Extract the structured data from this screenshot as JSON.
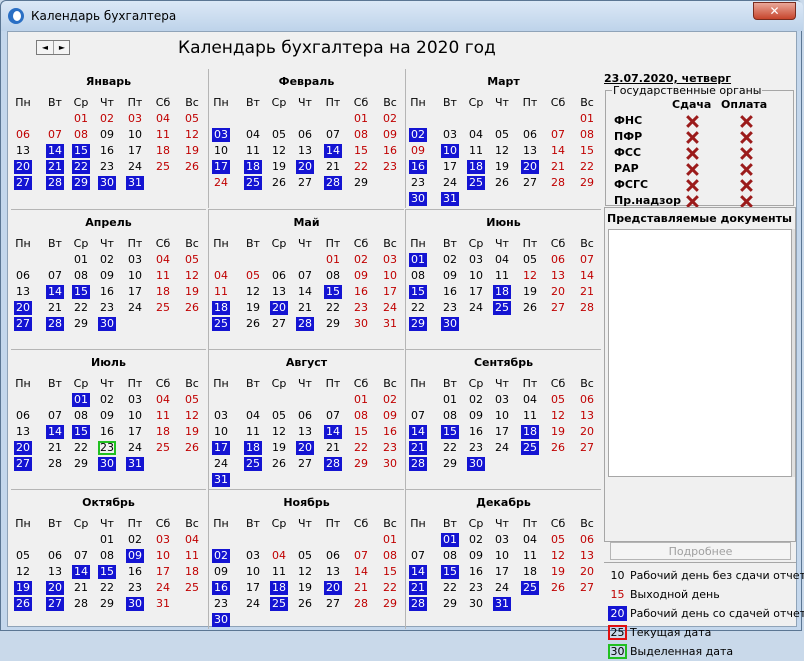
{
  "window": {
    "title": "Календарь бухгалтера",
    "close_label": "✕"
  },
  "nav": {
    "prev": "◄",
    "next": "►"
  },
  "header": {
    "title": "Календарь бухгалтера на 2020 год"
  },
  "weekdays": [
    "Пн",
    "Вт",
    "Ср",
    "Чт",
    "Пт",
    "Сб",
    "Вс"
  ],
  "months": [
    {
      "name": "Январь",
      "offset": 2,
      "days": 31,
      "weekends": [
        4,
        5,
        11,
        12,
        18,
        19,
        25,
        26
      ],
      "holidays": [
        1,
        2,
        3,
        6,
        7,
        8
      ],
      "reporting": [
        14,
        15,
        20,
        21,
        22,
        27,
        28,
        29,
        30,
        31
      ]
    },
    {
      "name": "Февраль",
      "offset": 5,
      "days": 29,
      "weekends": [
        1,
        2,
        8,
        9,
        15,
        16,
        22,
        23,
        24
      ],
      "holidays": [],
      "reporting": [
        3,
        14,
        17,
        18,
        20,
        25,
        28
      ]
    },
    {
      "name": "Март",
      "offset": 6,
      "days": 31,
      "weekends": [
        1,
        7,
        8,
        9,
        14,
        15,
        21,
        22,
        28,
        29
      ],
      "holidays": [],
      "reporting": [
        2,
        10,
        16,
        18,
        20,
        25,
        30,
        31
      ]
    },
    {
      "name": "Апрель",
      "offset": 2,
      "days": 30,
      "weekends": [
        4,
        5,
        11,
        12,
        18,
        19,
        25,
        26
      ],
      "holidays": [],
      "reporting": [
        14,
        15,
        20,
        27,
        28,
        30
      ]
    },
    {
      "name": "Май",
      "offset": 4,
      "days": 31,
      "weekends": [
        1,
        2,
        3,
        4,
        5,
        9,
        10,
        11,
        16,
        17,
        23,
        24,
        30,
        31
      ],
      "holidays": [],
      "reporting": [
        15,
        18,
        20,
        25,
        28
      ]
    },
    {
      "name": "Июнь",
      "offset": 0,
      "days": 30,
      "weekends": [
        6,
        7,
        12,
        13,
        14,
        20,
        21,
        27,
        28
      ],
      "holidays": [],
      "reporting": [
        1,
        15,
        18,
        25,
        29,
        30
      ]
    },
    {
      "name": "Июль",
      "offset": 2,
      "days": 31,
      "weekends": [
        4,
        5,
        11,
        12,
        18,
        19,
        25,
        26
      ],
      "holidays": [],
      "reporting": [
        1,
        14,
        15,
        20,
        27,
        30,
        31
      ]
    },
    {
      "name": "Август",
      "offset": 5,
      "days": 31,
      "weekends": [
        1,
        2,
        8,
        9,
        15,
        16,
        22,
        23,
        29,
        30
      ],
      "holidays": [],
      "reporting": [
        14,
        17,
        18,
        20,
        25,
        28,
        31
      ]
    },
    {
      "name": "Сентябрь",
      "offset": 1,
      "days": 30,
      "weekends": [
        5,
        6,
        12,
        13,
        19,
        20,
        26,
        27
      ],
      "holidays": [],
      "reporting": [
        14,
        15,
        18,
        21,
        25,
        28,
        30
      ]
    },
    {
      "name": "Октябрь",
      "offset": 3,
      "days": 31,
      "weekends": [
        3,
        4,
        10,
        11,
        17,
        18,
        24,
        25,
        31
      ],
      "holidays": [],
      "reporting": [
        9,
        14,
        15,
        19,
        20,
        26,
        27,
        30
      ]
    },
    {
      "name": "Ноябрь",
      "offset": 6,
      "days": 30,
      "weekends": [
        1,
        4,
        7,
        8,
        14,
        15,
        21,
        22,
        28,
        29
      ],
      "holidays": [],
      "reporting": [
        2,
        16,
        18,
        20,
        25,
        30
      ]
    },
    {
      "name": "Декабрь",
      "offset": 1,
      "days": 31,
      "weekends": [
        5,
        6,
        12,
        13,
        19,
        20,
        26,
        27
      ],
      "holidays": [],
      "reporting": [
        1,
        14,
        15,
        21,
        25,
        28,
        31
      ]
    }
  ],
  "selected": {
    "month": 6,
    "day": 23
  },
  "current_date": "23.07.2020, четверг",
  "gov": {
    "title": "Государственные органы",
    "col_submit": "Сдача",
    "col_pay": "Оплата",
    "orgs": [
      "ФНС",
      "ПФР",
      "ФСС",
      "РАР",
      "ФСГС",
      "Пр.надзор"
    ]
  },
  "docs": {
    "title": "Представляемые документы"
  },
  "more_button": "Подробнее",
  "legend": [
    {
      "sample": "10",
      "text": "Рабочий день без сдачи отчетов",
      "style": "plain"
    },
    {
      "sample": "15",
      "text": "Выходной день",
      "style": "red"
    },
    {
      "sample": "20",
      "text": "Рабочий день со сдачей отчетов",
      "style": "rep"
    },
    {
      "sample": "25",
      "text": "Текущая дата",
      "style": "cur"
    },
    {
      "sample": "30",
      "text": "Выделенная дата",
      "style": "sel2"
    }
  ],
  "colors": {
    "reporting": "#1414d2",
    "weekend": "#c00000",
    "selected_border": "#21c021",
    "current_border": "#e01010"
  }
}
